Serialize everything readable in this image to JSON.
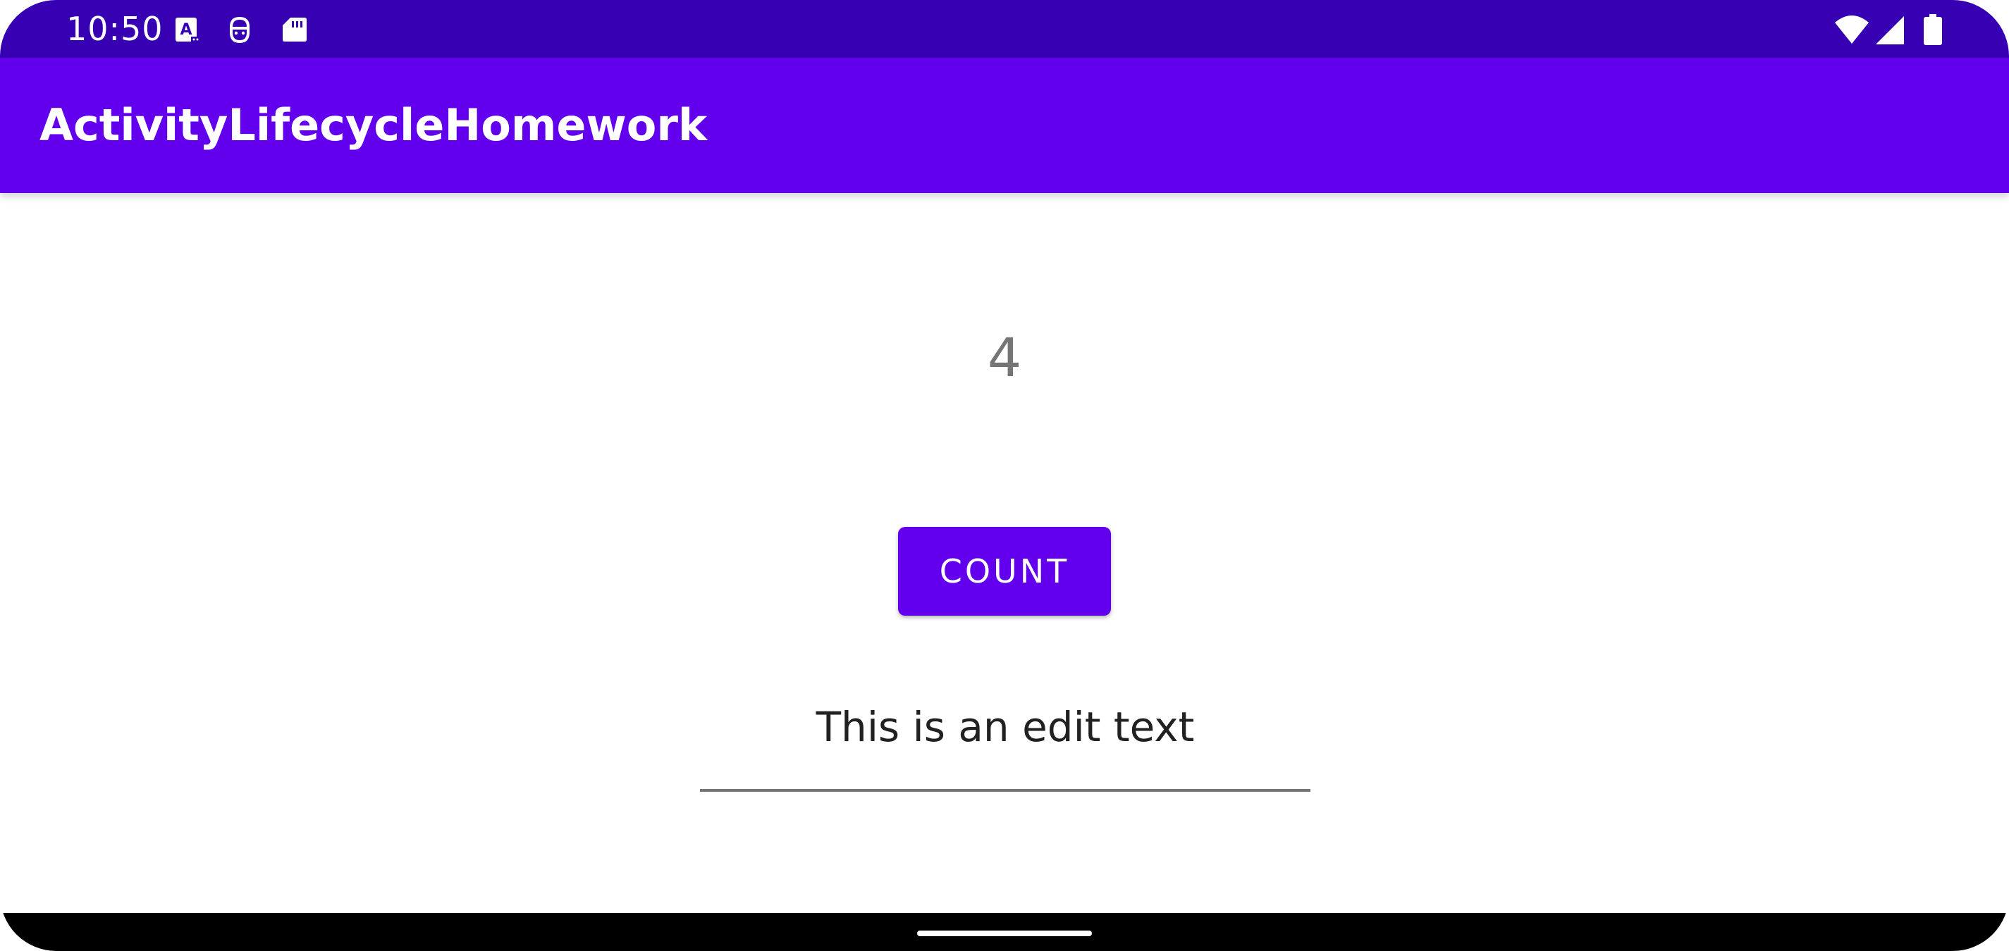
{
  "status_bar": {
    "time": "10:50",
    "left_icons": [
      "text-a-notification-icon",
      "face-notification-icon",
      "sd-card-icon"
    ],
    "right_icons": [
      "wifi-icon",
      "cellular-signal-icon",
      "battery-icon"
    ],
    "background": "#3700b3"
  },
  "app_bar": {
    "title": "ActivityLifecycleHomework",
    "background": "#6200ee"
  },
  "main": {
    "counter_value": "4",
    "count_button_label": "COUNT",
    "edit_text_value": "This is an edit text"
  },
  "colors": {
    "primary": "#6200ee",
    "primary_dark": "#3700b3",
    "counter_text": "#757575",
    "nav_bar": "#000000"
  }
}
